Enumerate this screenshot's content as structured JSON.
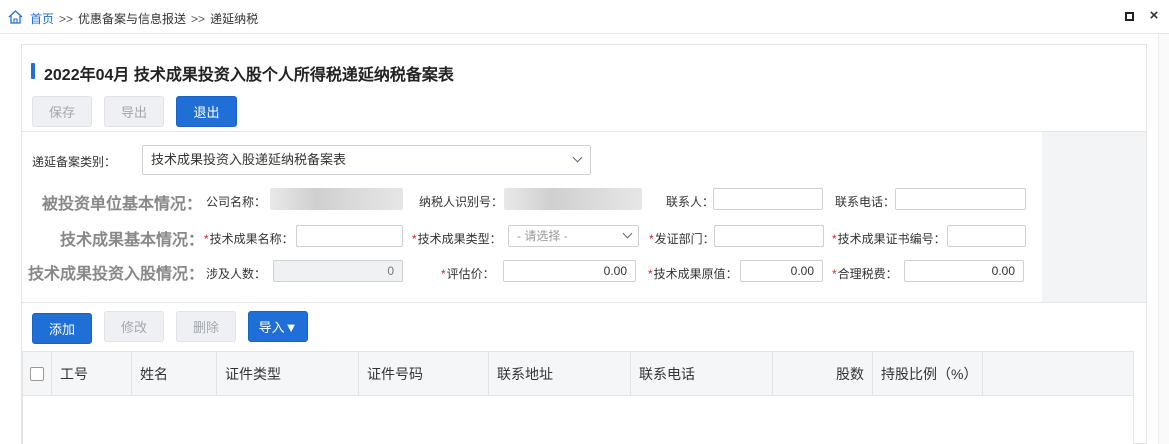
{
  "breadcrumb": {
    "home": "首页",
    "sep": ">>",
    "items": [
      "优惠备案与信息报送",
      "递延纳税"
    ]
  },
  "window": {
    "close": "×"
  },
  "page_title": "2022年04月  技术成果投资入股个人所得税递延纳税备案表",
  "toolbar": {
    "save": "保存",
    "export": "导出",
    "exit": "退出"
  },
  "form": {
    "type_label": "递延备案类别：",
    "type_value": "技术成果投资入股递延纳税备案表",
    "section1": {
      "title": "被投资单位基本情况：",
      "company_label": "公司名称：",
      "taxid_label": "纳税人识别号：",
      "contact_label": "联系人：",
      "phone_label": "联系电话："
    },
    "section2": {
      "title": "技术成果基本情况：",
      "name_label": "技术成果名称：",
      "type_label": "技术成果类型：",
      "type_placeholder": "- 请选择 -",
      "dept_label": "发证部门：",
      "cert_label": "技术成果证书编号："
    },
    "section3": {
      "title": "技术成果投资入股情况：",
      "people_label": "涉及人数：",
      "people_value": "0",
      "eval_label": "评估价：",
      "eval_value": "0.00",
      "orig_label": "技术成果原值：",
      "orig_value": "0.00",
      "fee_label": "合理税费：",
      "fee_value": "0.00"
    }
  },
  "table_toolbar": {
    "add": "添加",
    "edit": "修改",
    "delete": "删除",
    "import": "导入▼"
  },
  "table": {
    "columns": [
      "工号",
      "姓名",
      "证件类型",
      "证件号码",
      "联系地址",
      "联系电话",
      "股数",
      "持股比例（%）"
    ]
  },
  "colors": {
    "accent": "#1f6fd6",
    "required": "#e02020"
  }
}
